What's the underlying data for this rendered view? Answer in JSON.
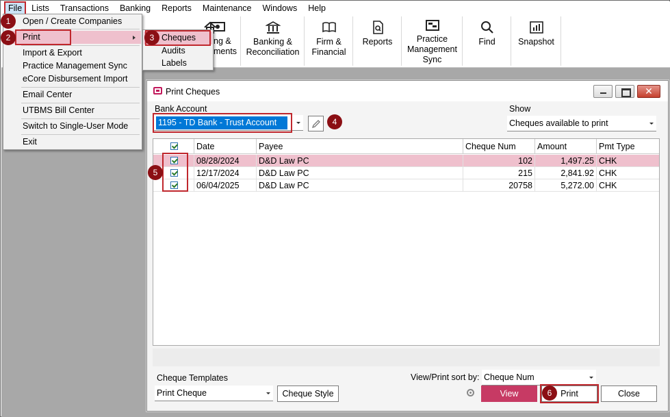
{
  "menubar": {
    "items": [
      "File",
      "Lists",
      "Transactions",
      "Banking",
      "Reports",
      "Maintenance",
      "Windows",
      "Help"
    ]
  },
  "toolbar": {
    "partial1": "ng &",
    "partial1b": "ments",
    "banking": [
      "Banking &",
      "Reconciliation"
    ],
    "firm": [
      "Firm &",
      "Financial"
    ],
    "reports": "Reports",
    "practice": [
      "Practice",
      "Management",
      "Sync"
    ],
    "find": "Find",
    "snapshot": "Snapshot"
  },
  "file_menu": {
    "items": [
      "Open / Create Companies",
      "Print",
      "Import & Export",
      "Practice Management Sync",
      "eCore Disbursement Import",
      "Email Center",
      "UTBMS Bill Center",
      "Switch to Single-User Mode",
      "Exit"
    ]
  },
  "print_menu": {
    "items": [
      "Cheques",
      "Audits",
      "Labels"
    ]
  },
  "badges": [
    "1",
    "2",
    "3",
    "4",
    "5",
    "6"
  ],
  "dialog": {
    "title": "Print Cheques",
    "bank_account_label": "Bank Account",
    "bank_account_value": "1195 - TD Bank - Trust Account",
    "show_label": "Show",
    "show_value": "Cheques available to print",
    "columns": [
      "Date",
      "Payee",
      "Cheque Num",
      "Amount",
      "Pmt Type"
    ],
    "rows": [
      {
        "date": "08/28/2024",
        "payee": "D&D Law PC",
        "cheque_num": "102",
        "amount": "1,497.25",
        "pmt_type": "CHK"
      },
      {
        "date": "12/17/2024",
        "payee": "D&D Law PC",
        "cheque_num": "215",
        "amount": "2,841.92",
        "pmt_type": "CHK"
      },
      {
        "date": "06/04/2025",
        "payee": "D&D Law PC",
        "cheque_num": "20758",
        "amount": "5,272.00",
        "pmt_type": "CHK"
      }
    ],
    "cheque_templates_label": "Cheque Templates",
    "cheque_template_value": "Print Cheque",
    "cheque_style_button": "Cheque Style",
    "sort_label": "View/Print sort by:",
    "sort_value": "Cheque Num",
    "view_button": "View",
    "print_button": "Print",
    "close_button": "Close"
  },
  "colors": {
    "highlight": "#efc0cd",
    "annotation_red": "#c0272d",
    "badge": "#8b0f14",
    "selection_blue": "#0078d7",
    "view_button": "#c73a64"
  }
}
